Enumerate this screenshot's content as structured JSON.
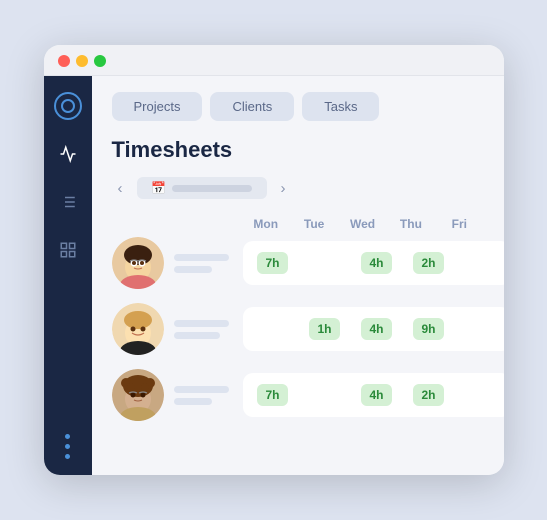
{
  "window": {
    "dots": [
      "red",
      "yellow",
      "green"
    ]
  },
  "tabs": [
    {
      "label": "Projects",
      "active": false
    },
    {
      "label": "Clients",
      "active": false
    },
    {
      "label": "Tasks",
      "active": false
    }
  ],
  "title": "Timesheets",
  "date_nav": {
    "prev_label": "‹",
    "next_label": "›"
  },
  "col_headers": [
    "Mon",
    "Tue",
    "Wed",
    "Thu",
    "Fri"
  ],
  "rows": [
    {
      "person": "person1",
      "hours": [
        {
          "col": "Mon",
          "value": "7h",
          "filled": true
        },
        {
          "col": "Tue",
          "value": "",
          "filled": false
        },
        {
          "col": "Wed",
          "value": "4h",
          "filled": true
        },
        {
          "col": "Thu",
          "value": "2h",
          "filled": true
        },
        {
          "col": "Fri",
          "value": "",
          "filled": false
        }
      ]
    },
    {
      "person": "person2",
      "hours": [
        {
          "col": "Mon",
          "value": "",
          "filled": false
        },
        {
          "col": "Tue",
          "value": "1h",
          "filled": true
        },
        {
          "col": "Wed",
          "value": "4h",
          "filled": true
        },
        {
          "col": "Thu",
          "value": "9h",
          "filled": true
        },
        {
          "col": "Fri",
          "value": "",
          "filled": false
        }
      ]
    },
    {
      "person": "person3",
      "hours": [
        {
          "col": "Mon",
          "value": "7h",
          "filled": true
        },
        {
          "col": "Tue",
          "value": "",
          "filled": false
        },
        {
          "col": "Wed",
          "value": "4h",
          "filled": true
        },
        {
          "col": "Thu",
          "value": "2h",
          "filled": true
        },
        {
          "col": "Fri",
          "value": "",
          "filled": false
        }
      ]
    }
  ],
  "sidebar": {
    "icons": [
      "chart-line-icon",
      "list-icon",
      "grid-icon"
    ]
  },
  "colors": {
    "sidebar_bg": "#1a2744",
    "badge_bg": "#d4f0d4",
    "badge_text": "#2a8a3a"
  }
}
